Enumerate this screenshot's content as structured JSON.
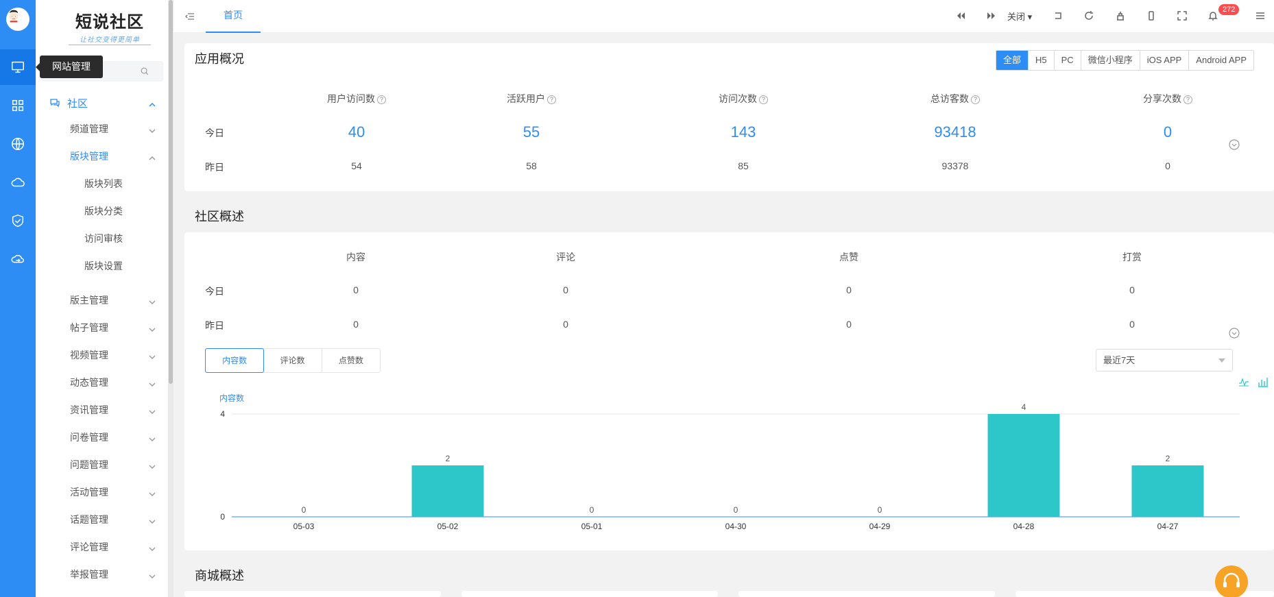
{
  "rail": {
    "items": [
      "monitor-icon",
      "grid-icon",
      "globe-icon",
      "cloud-icon",
      "shield-check-icon",
      "cloud-sync-icon"
    ]
  },
  "tooltip": "网站管理",
  "logo": {
    "title": "短说社区",
    "slogan": "让社交变得更简单"
  },
  "sidebar": {
    "top": "社区",
    "items": [
      {
        "label": "频道管理",
        "kind": "sub"
      },
      {
        "label": "版块管理",
        "kind": "sub-selected"
      },
      {
        "label": "版块列表",
        "kind": "leaf"
      },
      {
        "label": "版块分类",
        "kind": "leaf"
      },
      {
        "label": "访问审核",
        "kind": "leaf"
      },
      {
        "label": "版块设置",
        "kind": "leaf"
      },
      {
        "label": "版主管理",
        "kind": "sub"
      },
      {
        "label": "帖子管理",
        "kind": "sub"
      },
      {
        "label": "视频管理",
        "kind": "sub"
      },
      {
        "label": "动态管理",
        "kind": "sub"
      },
      {
        "label": "资讯管理",
        "kind": "sub"
      },
      {
        "label": "问卷管理",
        "kind": "sub"
      },
      {
        "label": "问题管理",
        "kind": "sub"
      },
      {
        "label": "活动管理",
        "kind": "sub"
      },
      {
        "label": "话题管理",
        "kind": "sub"
      },
      {
        "label": "评论管理",
        "kind": "sub"
      },
      {
        "label": "举报管理",
        "kind": "sub"
      }
    ]
  },
  "topbar": {
    "tab": "首页",
    "close_label": "关闭",
    "notif_count": "272"
  },
  "app_overview": {
    "title": "应用概况",
    "platforms": [
      "全部",
      "H5",
      "PC",
      "微信小程序",
      "iOS APP",
      "Android APP"
    ],
    "active_platform": "全部",
    "headers": [
      "用户访问数",
      "活跃用户",
      "访问次数",
      "总访客数",
      "分享次数"
    ],
    "row_labels": [
      "今日",
      "昨日"
    ],
    "today": [
      "40",
      "55",
      "143",
      "93418",
      "0"
    ],
    "yesterday": [
      "54",
      "58",
      "85",
      "93378",
      "0"
    ]
  },
  "community": {
    "title": "社区概述",
    "headers": [
      "内容",
      "评论",
      "点赞",
      "打赏"
    ],
    "row_labels": [
      "今日",
      "昨日"
    ],
    "today": [
      "0",
      "0",
      "0",
      "0"
    ],
    "yesterday": [
      "0",
      "0",
      "0",
      "0"
    ],
    "chart_tabs": [
      "内容数",
      "评论数",
      "点赞数"
    ],
    "range": "最近7天"
  },
  "mall": {
    "title": "商城概述"
  },
  "chart_data": {
    "type": "bar",
    "ylabel": "内容数",
    "categories": [
      "05-03",
      "05-02",
      "05-01",
      "04-30",
      "04-29",
      "04-28",
      "04-27"
    ],
    "values": [
      0,
      2,
      0,
      0,
      0,
      4,
      2
    ],
    "ylim": [
      0,
      4
    ],
    "yticks": [
      0,
      4
    ],
    "bar_color": "#2ec7c9"
  }
}
